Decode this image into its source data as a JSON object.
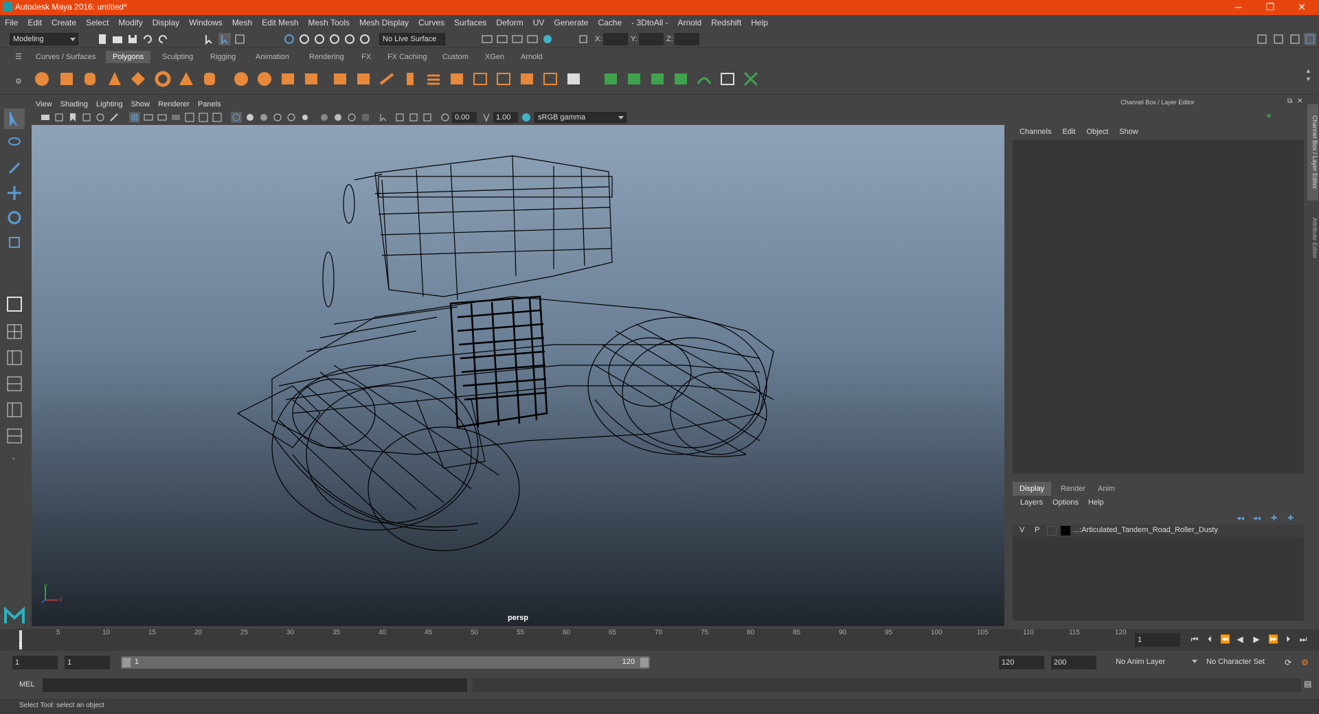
{
  "window": {
    "title": "Autodesk Maya 2016: untitled*",
    "minimize": "─",
    "restore": "❐",
    "close": "✕"
  },
  "menubar": [
    "File",
    "Edit",
    "Create",
    "Select",
    "Modify",
    "Display",
    "Windows",
    "Mesh",
    "Edit Mesh",
    "Mesh Tools",
    "Mesh Display",
    "Curves",
    "Surfaces",
    "Deform",
    "UV",
    "Generate",
    "Cache",
    "- 3DtoAll -",
    "Arnold",
    "Redshift",
    "Help"
  ],
  "statusline": {
    "menuset": "Modeling",
    "live_surface": "No Live Surface",
    "x_label": "X:",
    "y_label": "Y:",
    "z_label": "Z:"
  },
  "shelf": {
    "tabs": [
      "Curves / Surfaces",
      "Polygons",
      "Sculpting",
      "Rigging",
      "Animation",
      "Rendering",
      "FX",
      "FX Caching",
      "Custom",
      "XGen",
      "Arnold"
    ],
    "active_tab": "Polygons"
  },
  "viewport": {
    "menu": [
      "View",
      "Shading",
      "Lighting",
      "Show",
      "Renderer",
      "Panels"
    ],
    "exposure": "0.00",
    "gamma": "1.00",
    "colorspace": "sRGB gamma",
    "camera": "persp",
    "axis_x": "x",
    "axis_y": "y"
  },
  "channelbox": {
    "title": "Channel Box / Layer Editor",
    "menu": [
      "Channels",
      "Edit",
      "Object",
      "Show"
    ],
    "layer_tabs": [
      "Display",
      "Render",
      "Anim"
    ],
    "layer_menu": [
      "Layers",
      "Options",
      "Help"
    ],
    "layer": {
      "v": "V",
      "p": "P",
      "name": "...:Articulated_Tandem_Road_Roller_Dusty"
    },
    "side_tabs": [
      "Channel Box / Layer Editor",
      "Attribute Editor"
    ]
  },
  "timeline": {
    "ticks": [
      "5",
      "10",
      "15",
      "20",
      "25",
      "30",
      "35",
      "40",
      "45",
      "50",
      "55",
      "60",
      "65",
      "70",
      "75",
      "80",
      "85",
      "90",
      "95",
      "100",
      "105",
      "110",
      "115",
      "120"
    ],
    "start_marker": "1",
    "current_frame": "1"
  },
  "range": {
    "start": "1",
    "anim_start": "1",
    "slider_start": "1",
    "slider_end": "120",
    "anim_end": "120",
    "end": "200",
    "anim_layer": "No Anim Layer",
    "character_set": "No Character Set"
  },
  "cmdline": {
    "label": "MEL"
  },
  "helpline": {
    "text": "Select Tool: select an object"
  },
  "colors": {
    "title_bar": "#e8450e",
    "accent": "#5d9bd5",
    "shelf_icon": "#e8883a",
    "shelf_icon_green": "#3fa34d"
  }
}
